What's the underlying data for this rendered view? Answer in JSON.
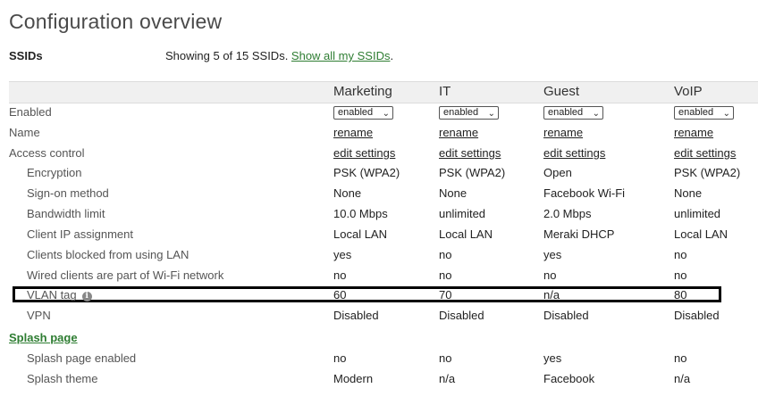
{
  "page": {
    "title": "Configuration overview"
  },
  "ssids": {
    "label": "SSIDs",
    "showing_text": "Showing 5 of 15 SSIDs. ",
    "show_all_link": "Show all my SSIDs",
    "showing_suffix": "."
  },
  "columns": [
    "Marketing",
    "IT",
    "Guest",
    "VoIP"
  ],
  "enabled_row": {
    "label": "Enabled",
    "values": [
      "enabled",
      "enabled",
      "enabled",
      "enabled"
    ]
  },
  "name_row": {
    "label": "Name",
    "links": [
      "rename",
      "rename",
      "rename",
      "rename"
    ]
  },
  "access_row": {
    "label": "Access control",
    "links": [
      "edit settings",
      "edit settings",
      "edit settings",
      "edit settings"
    ]
  },
  "rows": [
    {
      "label": "Encryption",
      "values": [
        "PSK (WPA2)",
        "PSK (WPA2)",
        "Open",
        "PSK (WPA2)"
      ]
    },
    {
      "label": "Sign-on method",
      "values": [
        "None",
        "None",
        "Facebook Wi-Fi",
        "None"
      ]
    },
    {
      "label": "Bandwidth limit",
      "values": [
        "10.0 Mbps",
        "unlimited",
        "2.0 Mbps",
        "unlimited"
      ]
    },
    {
      "label": "Client IP assignment",
      "values": [
        "Local LAN",
        "Local LAN",
        "Meraki DHCP",
        "Local LAN"
      ]
    },
    {
      "label": "Clients blocked from using LAN",
      "values": [
        "yes",
        "no",
        "yes",
        "no"
      ]
    },
    {
      "label": "Wired clients are part of Wi-Fi network",
      "values": [
        "no",
        "no",
        "no",
        "no"
      ]
    },
    {
      "label": "VLAN tag",
      "values": [
        "60",
        "70",
        "n/a",
        "80"
      ]
    },
    {
      "label": "VPN",
      "values": [
        "Disabled",
        "Disabled",
        "Disabled",
        "Disabled"
      ]
    }
  ],
  "splash": {
    "section_link": "Splash page",
    "rows": [
      {
        "label": "Splash page enabled",
        "values": [
          "no",
          "no",
          "yes",
          "no"
        ]
      },
      {
        "label": "Splash theme",
        "values": [
          "Modern",
          "n/a",
          "Facebook",
          "n/a"
        ]
      }
    ]
  },
  "icons": {
    "info": "info-icon",
    "dropdown": "chevron-down-icon"
  },
  "colors": {
    "link": "#2e7d32",
    "highlight_border": "#000000"
  }
}
